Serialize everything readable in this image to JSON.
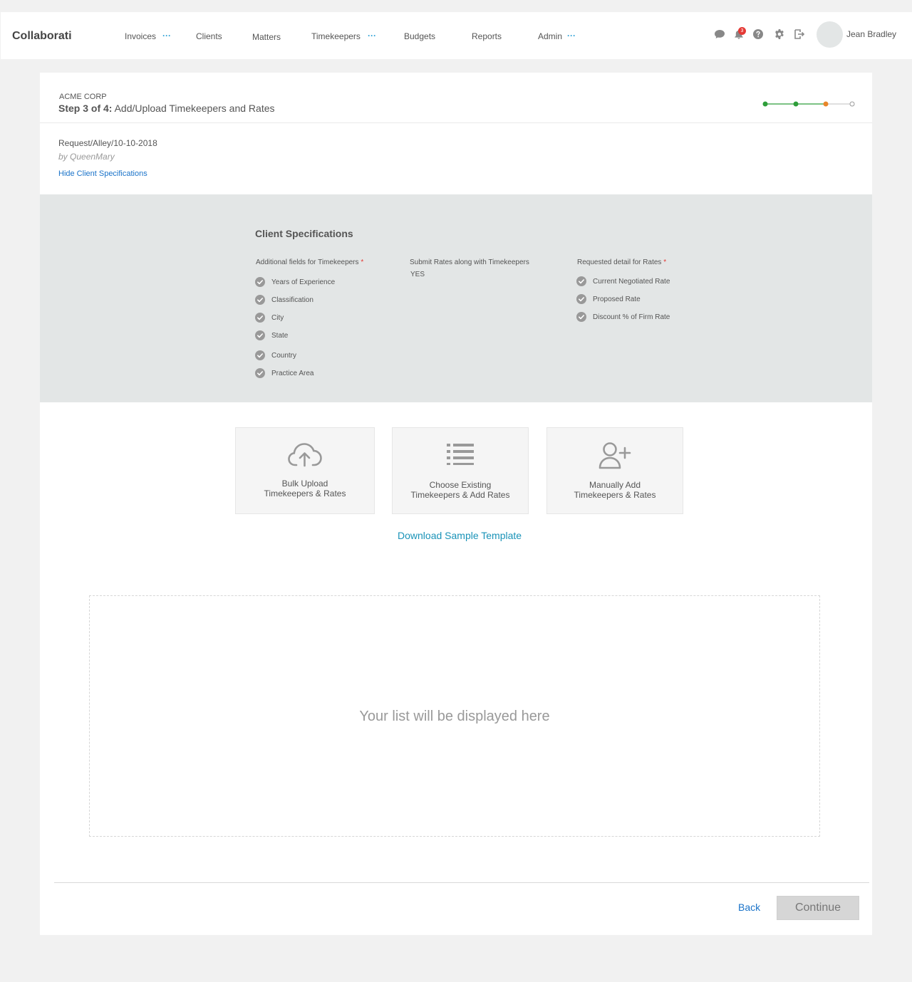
{
  "app": {
    "brand": "Collaborati"
  },
  "nav": {
    "invoices": "Invoices",
    "clients": "Clients",
    "matters": "Matters",
    "timekeepers": "Timekeepers",
    "budgets": "Budgets",
    "reports": "Reports",
    "admin": "Admin",
    "more": "···"
  },
  "header_icons": [
    "chat-icon",
    "bell-icon",
    "help-icon",
    "gear-icon",
    "logout-icon"
  ],
  "notifications": {
    "count": "3"
  },
  "user": {
    "name": "Jean Bradley"
  },
  "page": {
    "client": "ACME CORP",
    "step_prefix": "Step 3 of 4:",
    "step_title": "Add/Upload Timekeepers and Rates",
    "progress": {
      "total_steps": 4,
      "current_step": 3,
      "colors": {
        "done": "#2e9e3a",
        "current": "#e8862a",
        "pending": "#bbbbbb"
      }
    },
    "request_id": "Request/Alley/10-10-2018",
    "request_by": "by QueenMary",
    "hide_specs_link": "Hide Client Specifications"
  },
  "specs": {
    "title": "Client Specifications",
    "additional_fields": {
      "heading": "Additional fields for Timekeepers",
      "required": "*",
      "items": [
        "Years of Experience",
        "Classification",
        "City",
        "State",
        "Country",
        "Practice Area"
      ]
    },
    "submit_rates": {
      "heading": "Submit Rates along with Timekeepers",
      "value": "YES"
    },
    "rate_detail": {
      "heading": "Requested detail for Rates",
      "required": "*",
      "items": [
        "Current Negotiated Rate",
        "Proposed Rate",
        "Discount % of Firm Rate"
      ]
    }
  },
  "options": {
    "bulk_upload": {
      "line1": "Bulk Upload",
      "line2": "Timekeepers & Rates",
      "icon": "cloud-upload-icon"
    },
    "choose_existing": {
      "line1": "Choose Existing",
      "line2": "Timekeepers & Add Rates",
      "icon": "list-icon"
    },
    "manual_add": {
      "line1": "Manually Add",
      "line2": "Timekeepers & Rates",
      "icon": "user-plus-icon"
    }
  },
  "download_template": "Download Sample Template",
  "list_placeholder": "Your list will be displayed here",
  "footer": {
    "back": "Back",
    "continue": "Continue"
  }
}
